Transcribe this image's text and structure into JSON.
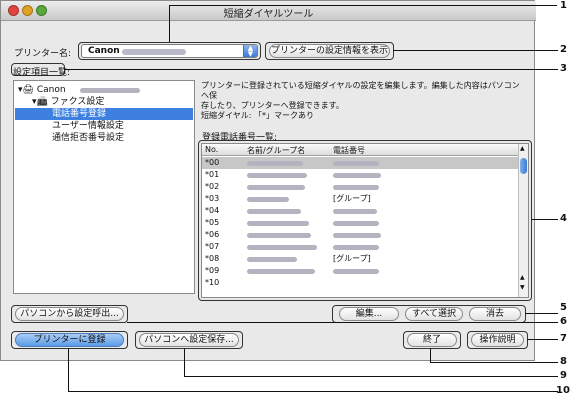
{
  "window": {
    "title": "短縮ダイヤルツール"
  },
  "printer": {
    "label": "プリンター名:",
    "selected": "Canon",
    "show_settings_button": "プリンターの設定情報を表示"
  },
  "settings_list": {
    "label": "設定項目一覧:",
    "tree": [
      {
        "label": "Canon",
        "level": 0,
        "icon": "printer-icon"
      },
      {
        "label": "ファクス設定",
        "level": 1,
        "icon": "fax-icon"
      },
      {
        "label": "電話番号登録",
        "level": 2,
        "selected": true
      },
      {
        "label": "ユーザー情報設定",
        "level": 2
      },
      {
        "label": "通信拒否番号設定",
        "level": 2
      }
    ]
  },
  "description": {
    "line1": "プリンターに登録されている短縮ダイヤルの設定を編集します。編集した内容はパソコンへ保",
    "line2": "存したり、プリンターへ登録できます。",
    "line3": "短縮ダイヤル: 「*」マークあり"
  },
  "phonebook": {
    "label": "登録電話番号一覧:",
    "headers": [
      "No.",
      "名前/グループ名",
      "電話番号"
    ],
    "rows": [
      {
        "no": "*00",
        "group": "",
        "selected": true
      },
      {
        "no": "*01",
        "group": ""
      },
      {
        "no": "*02",
        "group": ""
      },
      {
        "no": "*03",
        "group": "[グループ]"
      },
      {
        "no": "*04",
        "group": ""
      },
      {
        "no": "*05",
        "group": ""
      },
      {
        "no": "*06",
        "group": ""
      },
      {
        "no": "*07",
        "group": ""
      },
      {
        "no": "*08",
        "group": "[グループ]"
      },
      {
        "no": "*09",
        "group": ""
      },
      {
        "no": "*10",
        "group": ""
      }
    ]
  },
  "buttons": {
    "edit": "編集...",
    "select_all": "すべて選択",
    "delete": "消去",
    "load_from_pc": "パソコンから設定呼出...",
    "register_to_printer": "プリンターに登録",
    "save_to_pc": "パソコンへ設定保存...",
    "quit": "終了",
    "manual": "操作説明"
  },
  "callouts": [
    "1",
    "2",
    "3",
    "4",
    "5",
    "6",
    "7",
    "8",
    "9",
    "10"
  ],
  "colors": {
    "accent": "#3d80df",
    "close": "#e0443e",
    "minimize": "#dea123",
    "zoom": "#58a83a"
  }
}
